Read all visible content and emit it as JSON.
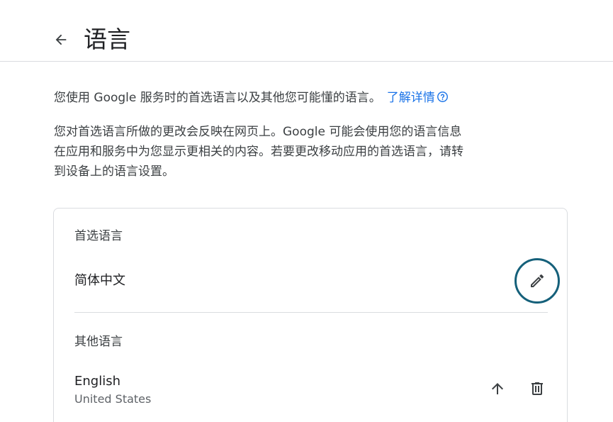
{
  "header": {
    "title": "语言",
    "back_icon": "arrow-back-icon"
  },
  "intro": {
    "text": "您使用 Google 服务时的首选语言以及其他您可能懂的语言。",
    "learn_more": "了解详情",
    "help_icon": "help-circle-icon",
    "link_color": "#1a73e8"
  },
  "description": {
    "lines": [
      "您对首选语言所做的更改会反映在网页上。Google 可能会使用您的语言信息",
      "在应用和服务中为您显示更相关的内容。若要更改移动应用的首选语言，请转",
      "到设备上的语言设置。"
    ]
  },
  "preferred": {
    "label": "首选语言",
    "language": "简体中文",
    "edit_icon": "pencil-icon",
    "edit_ring_color": "#15607a"
  },
  "other": {
    "label": "其他语言",
    "languages": [
      {
        "name": "English",
        "region": "United States",
        "move_up_icon": "arrow-up-icon",
        "delete_icon": "trash-icon"
      }
    ]
  },
  "watermark": {
    "logo_icon": "brand-logo-icon"
  }
}
